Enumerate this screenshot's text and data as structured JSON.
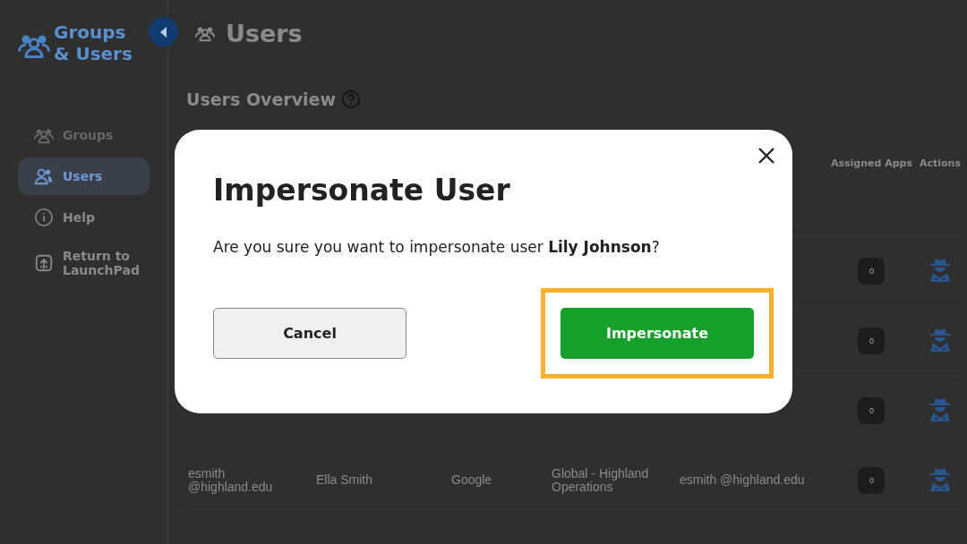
{
  "sidebar": {
    "title": "Groups & Users",
    "items": [
      {
        "label": "Groups",
        "selected": false,
        "disabled": true
      },
      {
        "label": "Users",
        "selected": true,
        "disabled": false
      },
      {
        "label": "Help",
        "selected": false,
        "disabled": false
      },
      {
        "label": "Return to LaunchPad",
        "selected": false,
        "disabled": false
      }
    ]
  },
  "header": {
    "title": "Users"
  },
  "section": {
    "title": "Users Overview"
  },
  "table": {
    "columns": [
      "Assigned Apps",
      "Actions"
    ],
    "rows": [
      {
        "cells": [],
        "assigned_apps": "0"
      },
      {
        "cells": [],
        "assigned_apps": "0"
      },
      {
        "cells": [],
        "assigned_apps": "0"
      },
      {
        "cells": [
          "esmith @highland.edu",
          "Ella Smith",
          "Google",
          "Global - Highland Operations",
          "esmith @highland.edu"
        ],
        "assigned_apps": "0"
      }
    ]
  },
  "dialog": {
    "title": "Impersonate User",
    "message": "Are you sure you want to impersonate user **Lily Johnson**?",
    "buttons": [
      {
        "label": "Cancel",
        "kind": "secondary",
        "focused": false
      },
      {
        "label": "Impersonate",
        "kind": "primary",
        "focused": true
      }
    ]
  }
}
